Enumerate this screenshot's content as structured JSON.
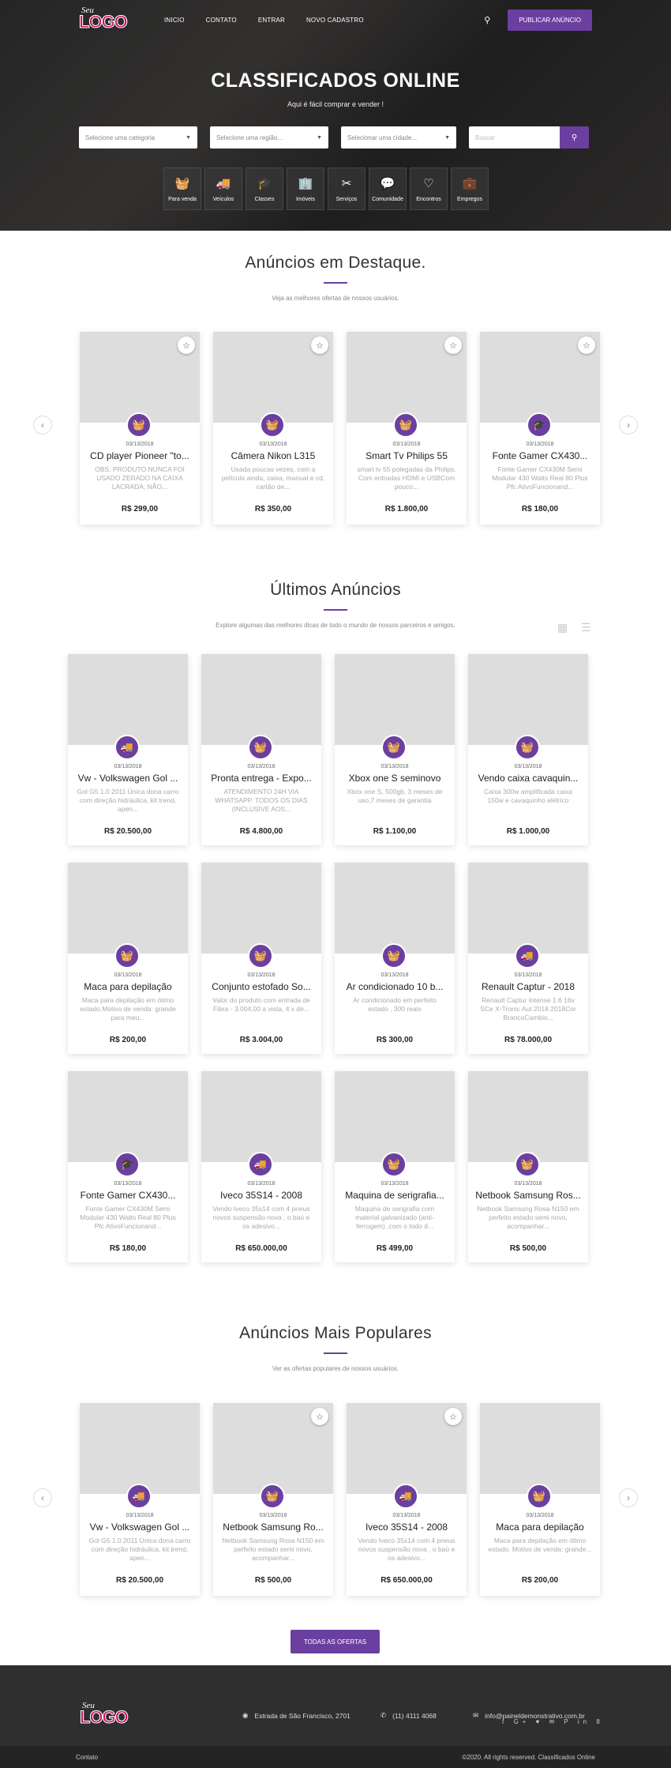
{
  "brand": {
    "logo_small": "Seu",
    "logo_big": "LOGO",
    "accent": "#6b3fa0"
  },
  "nav": {
    "items": [
      "INICIO",
      "CONTATO",
      "ENTRAR",
      "NOVO CADASTRO"
    ],
    "search_icon": "search-icon",
    "publish_label": "PUBLICAR ANÚNCIO"
  },
  "hero": {
    "title": "CLASSIFICADOS ONLINE",
    "subtitle": "Aqui é fácil comprar e vender !",
    "filters": {
      "category": "Selecione uma categoria",
      "region": "Selecione uma região...",
      "city": "Selecionar uma cidade...",
      "keyword_placeholder": "Buscar"
    },
    "categories": [
      {
        "label": "Para venda",
        "icon": "basket-icon"
      },
      {
        "label": "Veículos",
        "icon": "truck-icon"
      },
      {
        "label": "Classes",
        "icon": "graduation-cap-icon"
      },
      {
        "label": "Imóveis",
        "icon": "building-icon"
      },
      {
        "label": "Serviços",
        "icon": "tools-icon"
      },
      {
        "label": "Comunidade",
        "icon": "chat-icon"
      },
      {
        "label": "Encontros",
        "icon": "heart-icon"
      },
      {
        "label": "Empregos",
        "icon": "briefcase-icon"
      }
    ]
  },
  "featured": {
    "title": "Anúncios em Destaque.",
    "subtitle": "Veja as melhores ofertas de nossos usuários.",
    "cards": [
      {
        "date": "03/13/2018",
        "title": "CD player Pioneer \"to...",
        "desc": "OBS: PRODUTO NUNCA FOI USADO ZERADO NA CAIXA LACRADA, NÃO...",
        "price": "R$ 299,00",
        "icon": "basket-icon"
      },
      {
        "date": "03/13/2018",
        "title": "Câmera Nikon L315",
        "desc": "Usada poucas vezes, com a película ainda, caixa, manual e cd, cartão de...",
        "price": "R$ 350,00",
        "icon": "basket-icon"
      },
      {
        "date": "03/13/2018",
        "title": "Smart Tv Philips 55",
        "desc": "smart tv 55 polegadas da Philips. Com entradas HDMI e USBCom pouco...",
        "price": "R$ 1.800,00",
        "icon": "basket-icon"
      },
      {
        "date": "03/13/2018",
        "title": "Fonte Gamer CX430...",
        "desc": "Fonte Gamer CX430M Semi Modular 430 Watts Real 80 Plus Pfc AtivoFuncionand...",
        "price": "R$ 180,00",
        "icon": "graduation-cap-icon"
      }
    ]
  },
  "latest": {
    "title": "Últimos Anúncios",
    "subtitle": "Explore algumas das melhores dicas de todo o mundo de nossos parceiros e amigos.",
    "cards": [
      {
        "date": "03/13/2018",
        "title": "Vw - Volkswagen Gol ...",
        "desc": "Gol G5 1.0 2011 Única dona carro com direção hidráulica, kit trend, apen...",
        "price": "R$ 20.500,00",
        "icon": "truck-icon"
      },
      {
        "date": "03/13/2018",
        "title": "Pronta entrega - Expo...",
        "desc": "ATENDIMENTO 24H VIA WHATSAPP. TODOS OS DIAS (INCLUSIVE AOS...",
        "price": "R$ 4.800,00",
        "icon": "basket-icon"
      },
      {
        "date": "03/13/2018",
        "title": "Xbox one S seminovo",
        "desc": "Xbox one S, 500gb, 3 meses de uso,7 meses de garantia",
        "price": "R$ 1.100,00",
        "icon": "basket-icon"
      },
      {
        "date": "03/13/2018",
        "title": "Vendo caixa cavaquin...",
        "desc": "Caixa 300w amplificada caixa 150w e cavaquinho elétrico",
        "price": "R$ 1.000,00",
        "icon": "basket-icon"
      },
      {
        "date": "03/13/2018",
        "title": "Maca para depilação",
        "desc": "Maca para depilação em ótimo estado.Motivo de venda: grande para meu...",
        "price": "R$ 200,00",
        "icon": "basket-icon"
      },
      {
        "date": "03/13/2018",
        "title": "Conjunto estofado So...",
        "desc": "Valor do produto com entrada de Fibra - 3.004,00 a vista, 4 x de...",
        "price": "R$ 3.004,00",
        "icon": "basket-icon"
      },
      {
        "date": "03/13/2018",
        "title": "Ar condicionado 10 b...",
        "desc": "Ar condicionado em perfeito estado , 300 reais",
        "price": "R$ 300,00",
        "icon": "basket-icon"
      },
      {
        "date": "03/13/2018",
        "title": "Renault Captur - 2018",
        "desc": "Renault Captur Intense 1.6 16v SCe X-Tronic Aut 2018 2018Cor BrancoCambio...",
        "price": "R$ 78.000,00",
        "icon": "truck-icon"
      },
      {
        "date": "03/13/2018",
        "title": "Fonte Gamer CX430...",
        "desc": "Fonte Gamer CX430M Semi Modular 430 Watts Real 80 Plus Pfc AtivoFuncionand...",
        "price": "R$ 180,00",
        "icon": "graduation-cap-icon"
      },
      {
        "date": "03/13/2018",
        "title": "Iveco 35S14 - 2008",
        "desc": "Vendo Iveco 35s14 com 4 pneus novos suspensão nova , o baú e os adesivo...",
        "price": "R$ 650.000,00",
        "icon": "truck-icon"
      },
      {
        "date": "03/13/2018",
        "title": "Maquina de serigrafia...",
        "desc": "Maquina de serigrafia com material galvanizado (anti-ferrugem) ,com o todo d...",
        "price": "R$ 499,00",
        "icon": "basket-icon"
      },
      {
        "date": "03/13/2018",
        "title": "Netbook Samsung Ros...",
        "desc": "Netbook Samsung Rosa N150 em perfeito estado semi novo, acompanhar...",
        "price": "R$ 500,00",
        "icon": "basket-icon"
      }
    ]
  },
  "popular": {
    "title": "Anúncios Mais Populares",
    "subtitle": "Ver as ofertas populares de nossos usuários.",
    "cards": [
      {
        "date": "03/13/2018",
        "title": "Vw - Volkswagen Gol ...",
        "desc": "Gol G5 1.0 2011 Única dona carro com direção hidráulica, kit trend, apen...",
        "price": "R$ 20.500,00",
        "icon": "truck-icon"
      },
      {
        "date": "03/13/2018",
        "title": "Netbook Samsung Ro...",
        "desc": "Netbook Samsung Rosa N150 em perfeito estado semi novo, acompanhar...",
        "price": "R$ 500,00",
        "icon": "basket-icon"
      },
      {
        "date": "03/13/2018",
        "title": "Iveco 35S14 - 2008",
        "desc": "Vendo Iveco 35s14 com 4 pneus novos suspensão nova , o baú e os adesivo...",
        "price": "R$ 650.000,00",
        "icon": "truck-icon"
      },
      {
        "date": "03/13/2018",
        "title": "Maca para depilação",
        "desc": "Maca para depilação em ótimo estado. Motivo de venda: grande...",
        "price": "R$ 200,00",
        "icon": "basket-icon"
      }
    ],
    "all_offers_label": "TODAS AS OFERTAS"
  },
  "footer": {
    "address": "Estrada de São Francisco, 2701",
    "phone": "(11) 4111 4068",
    "email": "info@paineldemonstrativo.com.br",
    "social": "f G+ ♥ ✉ P in 8",
    "contact_label": "Contato",
    "copyright": "©2020. All rights reserved. Classificados Online"
  }
}
